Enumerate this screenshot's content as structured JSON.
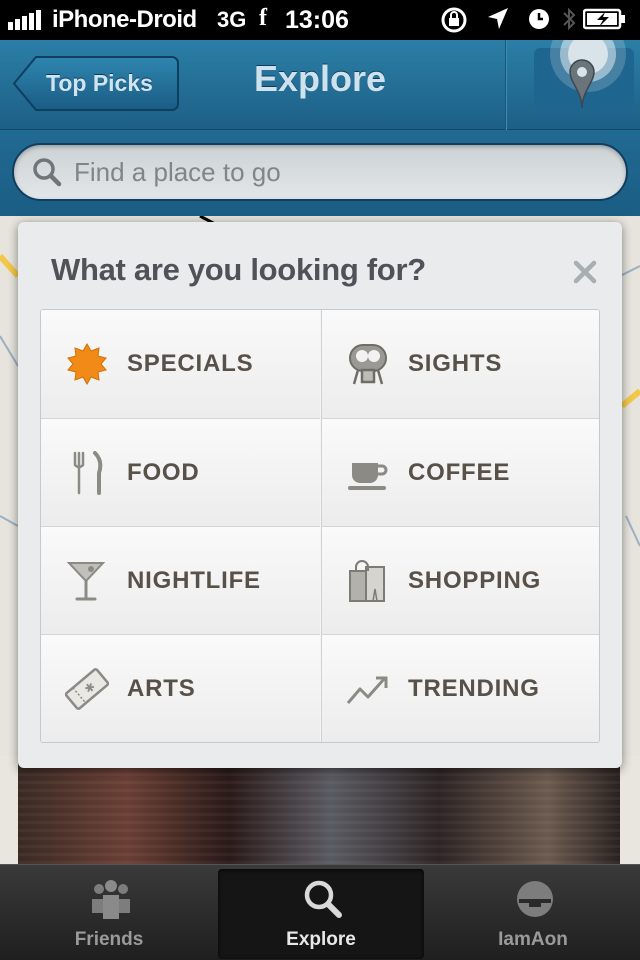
{
  "status_bar": {
    "carrier": "iPhone-Droid",
    "network": "3G",
    "facebook_glyph": "f",
    "time": "13:06",
    "icons": [
      "signal-bars-icon",
      "rotation-lock-icon",
      "location-arrow-icon",
      "alarm-clock-icon",
      "bluetooth-icon",
      "battery-charging-icon"
    ]
  },
  "nav": {
    "back_label": "Top Picks",
    "title": "Explore",
    "locate_icon": "location-pin-icon"
  },
  "search": {
    "placeholder": "Find a place to go"
  },
  "modal": {
    "title": "What are you looking for?",
    "close_glyph": "×",
    "categories": [
      {
        "label": "SPECIALS",
        "icon": "specials-badge-icon"
      },
      {
        "label": "SIGHTS",
        "icon": "binoculars-viewer-icon"
      },
      {
        "label": "FOOD",
        "icon": "fork-knife-icon"
      },
      {
        "label": "COFFEE",
        "icon": "coffee-cup-icon"
      },
      {
        "label": "NIGHTLIFE",
        "icon": "cocktail-glass-icon"
      },
      {
        "label": "SHOPPING",
        "icon": "shopping-bag-icon"
      },
      {
        "label": "ARTS",
        "icon": "ticket-icon"
      },
      {
        "label": "TRENDING",
        "icon": "trending-arrow-icon"
      }
    ]
  },
  "tabs": [
    {
      "label": "Friends",
      "icon": "friends-group-icon",
      "active": false
    },
    {
      "label": "Explore",
      "icon": "search-icon",
      "active": true
    },
    {
      "label": "IamAon",
      "icon": "user-avatar-icon",
      "active": false
    }
  ],
  "colors": {
    "nav_blue": "#1d6a95",
    "specials_orange": "#f08a1e",
    "category_text": "#57514a"
  }
}
